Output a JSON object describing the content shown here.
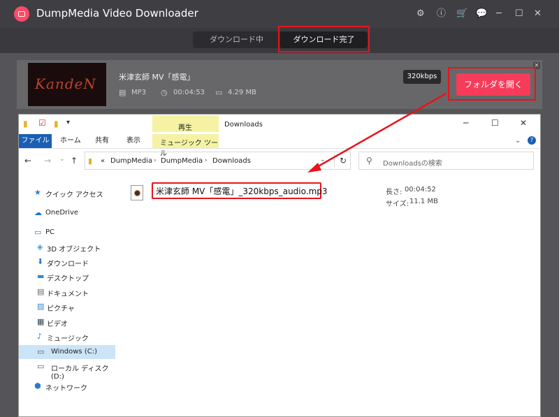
{
  "app": {
    "title": "DumpMedia Video Downloader",
    "window_controls": [
      "gear-icon",
      "info-icon",
      "cart-icon",
      "chat-icon",
      "minimize-icon",
      "maximize-icon",
      "close-icon"
    ]
  },
  "tabs": {
    "downloading": "ダウンロード中",
    "completed": "ダウンロード完了"
  },
  "item": {
    "title": "米津玄師 MV「感電」",
    "format": "MP3",
    "duration": "00:04:53",
    "size": "4.29 MB",
    "bitrate": "320kbps",
    "open_folder": "フォルダを開く",
    "thumb_text": "KandeN"
  },
  "explorer": {
    "window_title": "Downloads",
    "context_tab": "再生",
    "ribbon": {
      "file": "ファイル",
      "home": "ホーム",
      "share": "共有",
      "view": "表示",
      "music_tools": "ミュージック ツール"
    },
    "address": {
      "prefix": "«",
      "segments": [
        "DumpMedia",
        "DumpMedia",
        "Downloads"
      ]
    },
    "search_placeholder": "Downloadsの検索",
    "nav": [
      {
        "label": "クイック アクセス",
        "icon": "star-icon"
      },
      {
        "label": "OneDrive",
        "icon": "cloud-icon"
      },
      {
        "label": "PC",
        "icon": "computer-icon"
      },
      {
        "label": "3D オブジェクト",
        "icon": "cube-icon"
      },
      {
        "label": "ダウンロード",
        "icon": "download-icon"
      },
      {
        "label": "デスクトップ",
        "icon": "desktop-icon"
      },
      {
        "label": "ドキュメント",
        "icon": "document-icon"
      },
      {
        "label": "ピクチャ",
        "icon": "picture-icon"
      },
      {
        "label": "ビデオ",
        "icon": "video-icon"
      },
      {
        "label": "ミュージック",
        "icon": "music-icon"
      },
      {
        "label": "Windows (C:)",
        "icon": "drive-icon"
      },
      {
        "label": "ローカル ディスク (D:)",
        "icon": "disk-icon"
      },
      {
        "label": "ネットワーク",
        "icon": "network-icon"
      }
    ],
    "file": {
      "name": "米津玄師 MV「感電」_320kbps_audio.mp3",
      "length_label": "長さ:",
      "length": "00:04:52",
      "size_label": "サイズ:",
      "size": "11.1 MB"
    }
  },
  "colors": {
    "accent": "#f73b5a",
    "highlight": "#e8131b",
    "explorer_blue": "#1a5fb4"
  }
}
